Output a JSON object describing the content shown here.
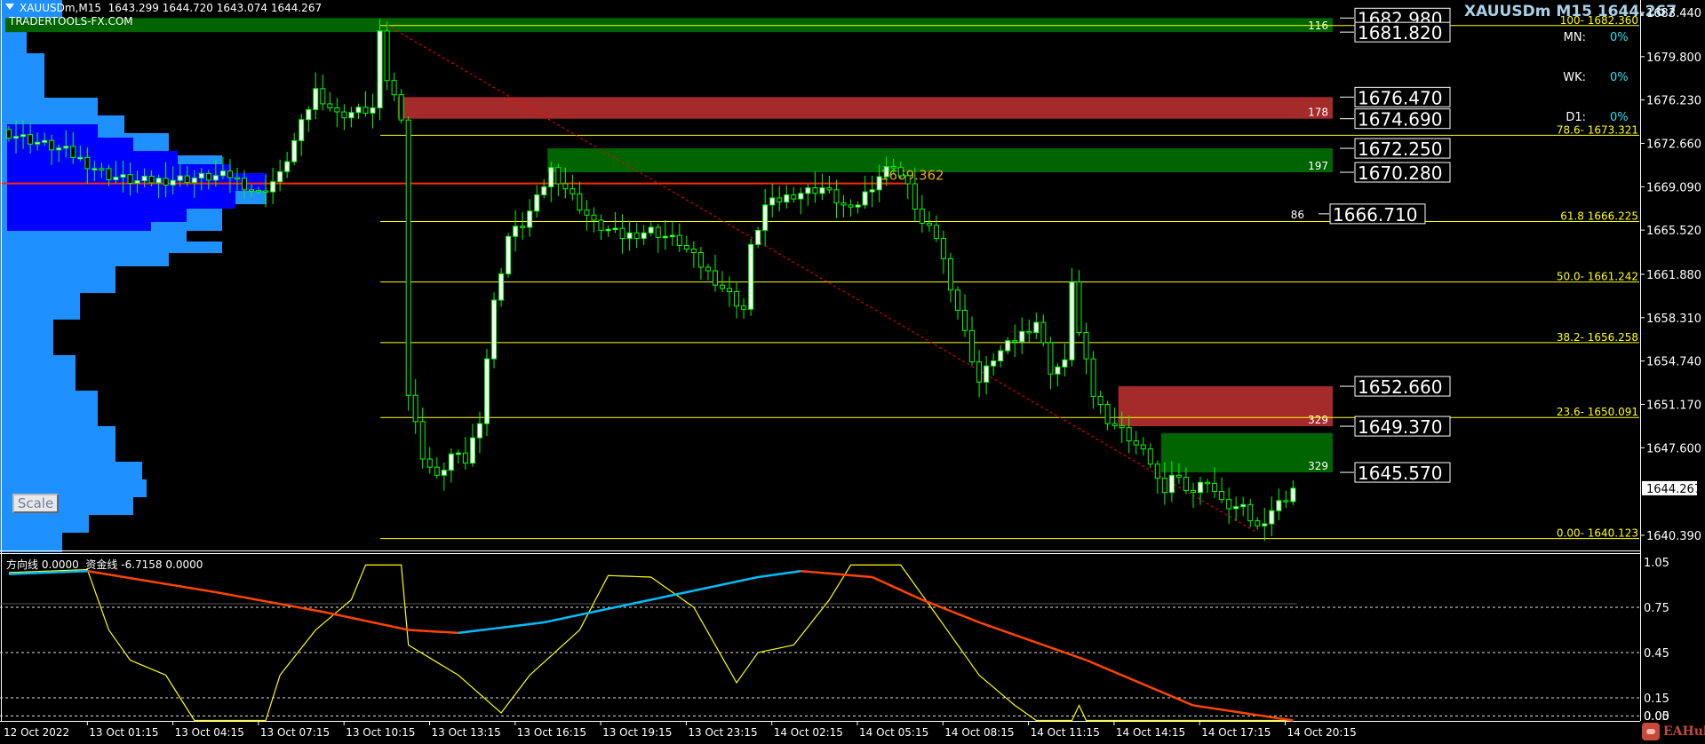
{
  "header": {
    "symbol_line": "XAUUSDm,M15  1643.299 1644.720 1643.074 1644.267",
    "brand": "TRADERTOOLS-FX.COM"
  },
  "info_panel": {
    "title": "XAUUSDm M15 1644.267",
    "stats": [
      {
        "label": "MN:",
        "value": "0%"
      },
      {
        "label": "WK:",
        "value": "0%"
      },
      {
        "label": "D1:",
        "value": "0%"
      }
    ]
  },
  "scale_button": "Scale",
  "indicator_title": "方向线 0.0000  资金线 -6.7158 0.0000",
  "watermark": "EAHub",
  "colors": {
    "background": "#000000",
    "candle": "#00ff00",
    "candle_body": "#ffffff",
    "fib": "#ffff00",
    "supply_zone": "#a52a2a",
    "demand_zone": "#006400",
    "profile": "#1e90ff",
    "profile_value_area": "#0000ff",
    "poc_line": "#ff2a00",
    "trendline": "#ff0000",
    "indicator_yellow": "#ffff00",
    "indicator_up": "#00bfff",
    "indicator_down": "#ff4500"
  },
  "chart_data": [
    {
      "type": "candlestick",
      "title": "XAUUSDm,M15",
      "ylim": [
        1639.2,
        1684.5
      ],
      "y_ticks": [
        "1683.440",
        "1679.800",
        "1676.230",
        "1672.660",
        "1669.090",
        "1665.520",
        "1661.880",
        "1658.310",
        "1654.740",
        "1651.170",
        "1647.600",
        "1640.390"
      ],
      "x_ticks": [
        "12 Oct 2022",
        "13 Oct 01:15",
        "13 Oct 04:15",
        "13 Oct 07:15",
        "13 Oct 10:15",
        "13 Oct 13:15",
        "13 Oct 16:15",
        "13 Oct 19:15",
        "13 Oct 23:15",
        "14 Oct 02:15",
        "14 Oct 05:15",
        "14 Oct 08:15",
        "14 Oct 11:15",
        "14 Oct 14:15",
        "14 Oct 17:15",
        "14 Oct 20:15"
      ],
      "bar_count": 181,
      "close_keyframes": [
        [
          0,
          1673.5
        ],
        [
          8,
          1672
        ],
        [
          14,
          1670
        ],
        [
          18,
          1669.5
        ],
        [
          31,
          1670
        ],
        [
          35,
          1668.5
        ],
        [
          38,
          1670
        ],
        [
          43,
          1677
        ],
        [
          46,
          1675
        ],
        [
          51,
          1675.5
        ],
        [
          52,
          1681.5
        ],
        [
          53,
          1678
        ],
        [
          55,
          1675
        ],
        [
          56,
          1652
        ],
        [
          58,
          1647
        ],
        [
          60,
          1645
        ],
        [
          62,
          1647
        ],
        [
          64,
          1646.5
        ],
        [
          66,
          1650
        ],
        [
          67,
          1655
        ],
        [
          68,
          1659.5
        ],
        [
          70,
          1665
        ],
        [
          72,
          1666
        ],
        [
          74,
          1668
        ],
        [
          76,
          1670.5
        ],
        [
          78,
          1669
        ],
        [
          82,
          1666
        ],
        [
          86,
          1665
        ],
        [
          90,
          1665.5
        ],
        [
          94,
          1664.5
        ],
        [
          98,
          1662
        ],
        [
          103,
          1659
        ],
        [
          104,
          1664
        ],
        [
          106,
          1667.5
        ],
        [
          110,
          1668.5
        ],
        [
          114,
          1669
        ],
        [
          118,
          1667
        ],
        [
          122,
          1670
        ],
        [
          124,
          1671
        ],
        [
          126,
          1669
        ],
        [
          128,
          1666
        ],
        [
          130,
          1665
        ],
        [
          132,
          1661
        ],
        [
          134,
          1657
        ],
        [
          136,
          1653
        ],
        [
          138,
          1655
        ],
        [
          141,
          1656.5
        ],
        [
          144,
          1658
        ],
        [
          146,
          1654
        ],
        [
          148,
          1654.5
        ],
        [
          149,
          1661.5
        ],
        [
          150,
          1657
        ],
        [
          152,
          1652
        ],
        [
          154,
          1650
        ],
        [
          157,
          1648.5
        ],
        [
          160,
          1646.5
        ],
        [
          162,
          1643.5
        ],
        [
          163,
          1645.5
        ],
        [
          166,
          1644
        ],
        [
          168,
          1645
        ],
        [
          170,
          1643
        ],
        [
          173,
          1642.5
        ],
        [
          175,
          1641
        ],
        [
          177,
          1642.5
        ],
        [
          179,
          1643.5
        ],
        [
          180,
          1644.267
        ]
      ],
      "current_price": "1644.267",
      "fib_levels": [
        {
          "label": "100- 1682.360",
          "price": 1682.36
        },
        {
          "label": "78.6- 1673.321",
          "price": 1673.321
        },
        {
          "label": "61.8 1666.225",
          "price": 1666.225
        },
        {
          "label": "50.0- 1661.242",
          "price": 1661.242
        },
        {
          "label": "38.2- 1656.258",
          "price": 1656.258
        },
        {
          "label": "23.6- 1650.091",
          "price": 1650.091
        },
        {
          "label": "0.00- 1640.123",
          "price": 1640.123
        }
      ],
      "zones": [
        {
          "kind": "demand",
          "top": 1682.98,
          "bottom": 1681.82,
          "start_bar": 0,
          "count": "116",
          "top_label": "1682.980",
          "bottom_label": "1681.820"
        },
        {
          "kind": "supply",
          "top": 1676.47,
          "bottom": 1674.69,
          "start_bar": 55,
          "count": "178",
          "top_label": "1676.470",
          "bottom_label": "1674.690"
        },
        {
          "kind": "demand",
          "top": 1672.25,
          "bottom": 1670.28,
          "start_bar": 76,
          "count": "197",
          "top_label": "1672.250",
          "bottom_label": "1670.280"
        },
        {
          "kind": "supply",
          "top": 1652.66,
          "bottom": 1649.37,
          "start_bar": 156,
          "count": "329",
          "top_label": "1652.660",
          "bottom_label": "1649.370"
        },
        {
          "kind": "demand",
          "top": 1648.8,
          "bottom": 1645.57,
          "start_bar": 162,
          "count": "329",
          "top_label": "",
          "bottom_label": "1645.570"
        }
      ],
      "level_marker": {
        "count": "86",
        "label": "1666.710",
        "price": 1666.71
      },
      "poc_line": {
        "price": 1669.362,
        "label": "1669.362"
      },
      "trendline": {
        "from": [
          53,
          1682.4
        ],
        "to": [
          175,
          1640.6
        ]
      }
    },
    {
      "type": "line",
      "title": "方向线 / 资金线",
      "ylim": [
        0,
        1.05
      ],
      "y_ticks": [
        "1.05",
        "0.75",
        "0.45",
        "0.15",
        "0.05",
        "0.00"
      ],
      "levels": [
        0.75,
        0.45,
        0.15,
        0.03
      ],
      "series": [
        {
          "name": "方向线",
          "keyframes": [
            [
              0,
              0.98
            ],
            [
              11,
              1.0
            ],
            [
              14,
              0.6
            ],
            [
              17,
              0.4
            ],
            [
              22,
              0.3
            ],
            [
              26,
              0.0
            ],
            [
              36,
              0.0
            ],
            [
              38,
              0.3
            ],
            [
              43,
              0.6
            ],
            [
              48,
              0.8
            ],
            [
              50,
              1.03
            ],
            [
              55,
              1.03
            ],
            [
              56,
              0.5
            ],
            [
              63,
              0.3
            ],
            [
              69,
              0.05
            ],
            [
              73,
              0.3
            ],
            [
              80,
              0.6
            ],
            [
              84,
              0.96
            ],
            [
              90,
              0.95
            ],
            [
              96,
              0.75
            ],
            [
              102,
              0.25
            ],
            [
              105,
              0.45
            ],
            [
              110,
              0.5
            ],
            [
              115,
              0.8
            ],
            [
              118,
              1.03
            ],
            [
              125,
              1.03
            ],
            [
              130,
              0.7
            ],
            [
              136,
              0.3
            ],
            [
              141,
              0.1
            ],
            [
              144,
              0.0
            ],
            [
              149,
              0.0
            ],
            [
              150,
              0.1
            ],
            [
              151,
              0.0
            ],
            [
              180,
              0.0
            ]
          ]
        },
        {
          "name": "资金线",
          "keyframes": [
            [
              0,
              0.97
            ],
            [
              11,
              0.99
            ],
            [
              29,
              0.85
            ],
            [
              44,
              0.72
            ],
            [
              56,
              0.6
            ],
            [
              63,
              0.58
            ],
            [
              75,
              0.65
            ],
            [
              90,
              0.8
            ],
            [
              105,
              0.95
            ],
            [
              111,
              0.99
            ],
            [
              121,
              0.95
            ],
            [
              128,
              0.8
            ],
            [
              136,
              0.65
            ],
            [
              151,
              0.4
            ],
            [
              166,
              0.1
            ],
            [
              180,
              0.0
            ]
          ]
        }
      ]
    }
  ]
}
